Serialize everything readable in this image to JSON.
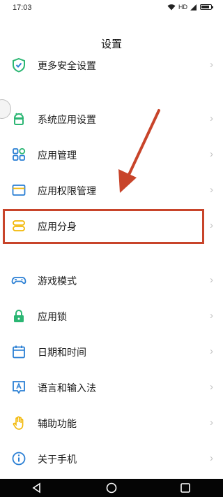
{
  "status": {
    "time": "17:03",
    "network": "HD"
  },
  "header": {
    "title": "设置"
  },
  "items": [
    {
      "label": "更多安全设置",
      "icon": "shield-check-icon"
    },
    {
      "label": "系统应用设置",
      "icon": "android-icon"
    },
    {
      "label": "应用管理",
      "icon": "apps-grid-icon"
    },
    {
      "label": "应用权限管理",
      "icon": "window-icon"
    },
    {
      "label": "应用分身",
      "icon": "dual-app-icon"
    },
    {
      "label": "游戏模式",
      "icon": "gamepad-icon"
    },
    {
      "label": "应用锁",
      "icon": "lock-icon"
    },
    {
      "label": "日期和时间",
      "icon": "calendar-icon"
    },
    {
      "label": "语言和输入法",
      "icon": "language-icon"
    },
    {
      "label": "辅助功能",
      "icon": "hand-icon"
    },
    {
      "label": "关于手机",
      "icon": "info-icon"
    }
  ],
  "colors": {
    "accent": "#2a7fd4",
    "highlight": "#c8442a",
    "green": "#2bb673",
    "yellow": "#f2b705"
  }
}
